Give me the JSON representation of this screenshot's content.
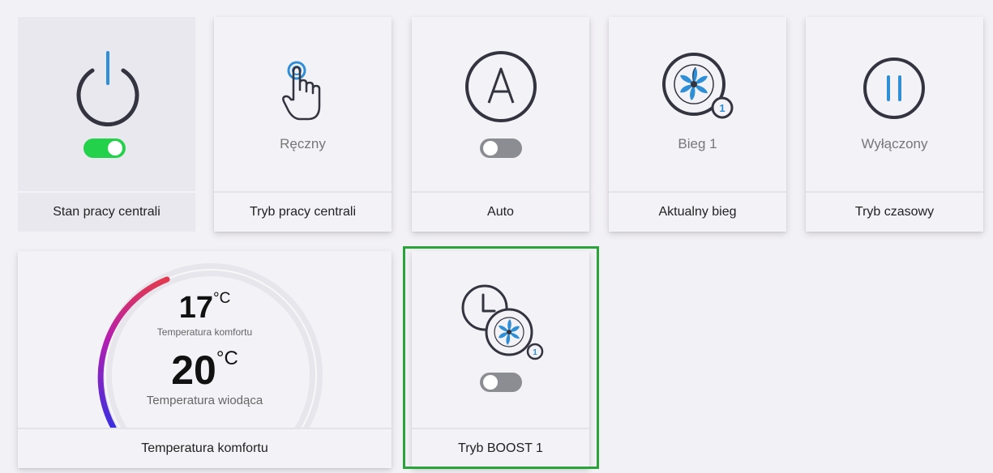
{
  "tiles": {
    "power": {
      "label": "Stan pracy centrali",
      "toggle": "on",
      "icon": "power-icon"
    },
    "mode": {
      "label": "Tryb pracy centrali",
      "value": "Ręczny",
      "icon": "hand-tap-icon"
    },
    "auto": {
      "label": "Auto",
      "toggle": "off",
      "icon": "auto-a-icon"
    },
    "gear": {
      "label": "Aktualny bieg",
      "value": "Bieg 1",
      "icon": "fan-speed-1-icon",
      "badge": "1"
    },
    "timer": {
      "label": "Tryb czasowy",
      "value": "Wyłączony",
      "icon": "pause-icon"
    },
    "temperature": {
      "label": "Temperatura komfortu",
      "comfort_value": "17",
      "comfort_unit": "°C",
      "comfort_caption": "Temperatura komfortu",
      "lead_value": "20",
      "lead_unit": "°C",
      "lead_caption": "Temperatura wiodąca"
    },
    "boost": {
      "label": "Tryb BOOST 1",
      "toggle": "off",
      "icon": "clock-fan-boost-icon",
      "badge": "1"
    }
  },
  "colors": {
    "accent_blue": "#2f8fd6",
    "icon_dark": "#33343f",
    "toggle_on": "#23d14a",
    "toggle_off": "#8b8d93",
    "highlight": "#2aa33b"
  }
}
